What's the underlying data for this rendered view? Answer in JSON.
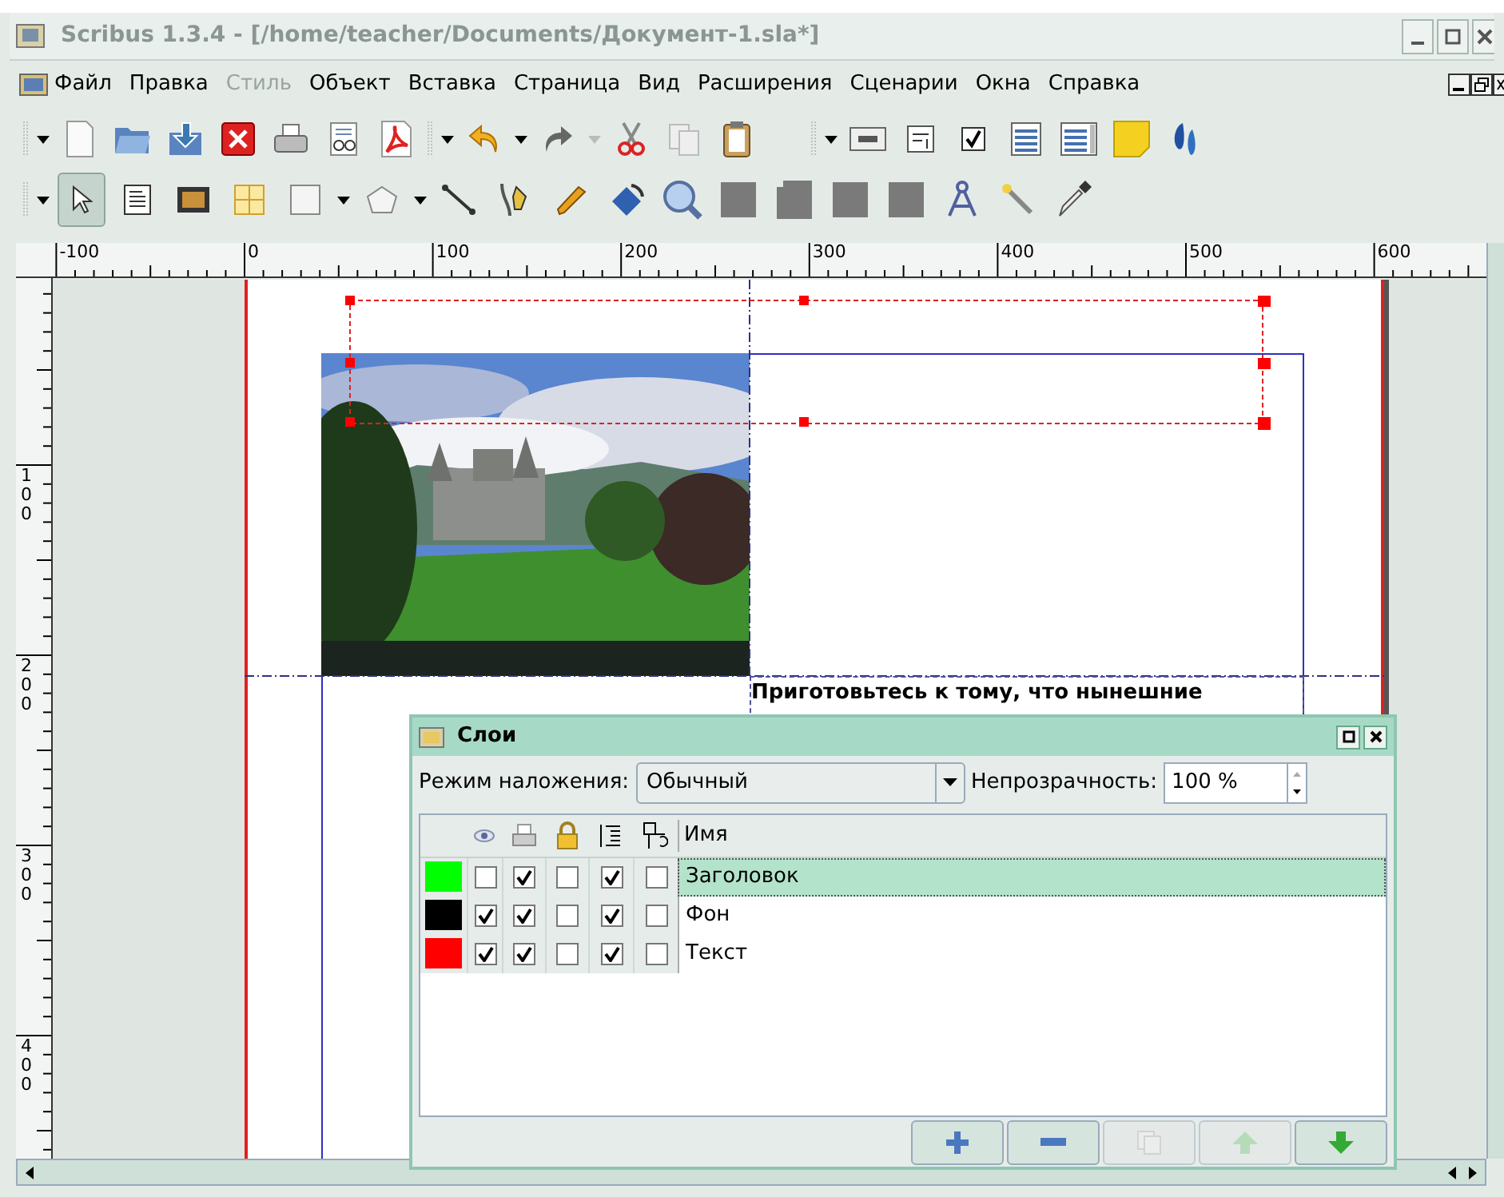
{
  "window": {
    "title": "Scribus 1.3.4 - [/home/teacher/Documents/Документ-1.sla*]"
  },
  "menu": [
    {
      "label": "Файл",
      "disabled": false
    },
    {
      "label": "Правка",
      "disabled": false
    },
    {
      "label": "Стиль",
      "disabled": true
    },
    {
      "label": "Объект",
      "disabled": false
    },
    {
      "label": "Вставка",
      "disabled": false
    },
    {
      "label": "Страница",
      "disabled": false
    },
    {
      "label": "Вид",
      "disabled": false
    },
    {
      "label": "Расширения",
      "disabled": false
    },
    {
      "label": "Сценарии",
      "disabled": false
    },
    {
      "label": "Окна",
      "disabled": false
    },
    {
      "label": "Справка",
      "disabled": false
    }
  ],
  "toolbox": [
    {
      "kind": "pointer",
      "selected": true
    },
    {
      "kind": "text_frame",
      "selected": false
    },
    {
      "kind": "image_frame",
      "selected": false
    },
    {
      "kind": "table",
      "selected": false
    },
    {
      "kind": "shape",
      "selected": false
    },
    {
      "kind": "polygon",
      "selected": false
    },
    {
      "kind": "line",
      "selected": false
    },
    {
      "kind": "bezier",
      "selected": false
    },
    {
      "kind": "freehand",
      "selected": false
    },
    {
      "kind": "rotate",
      "selected": false
    },
    {
      "kind": "zoom",
      "selected": false
    },
    {
      "kind": "block",
      "selected": false
    },
    {
      "kind": "block_tab",
      "selected": false
    },
    {
      "kind": "block",
      "selected": false
    },
    {
      "kind": "block",
      "selected": false
    },
    {
      "kind": "measure",
      "selected": false
    },
    {
      "kind": "link",
      "selected": false
    },
    {
      "kind": "eyedropper",
      "selected": false
    }
  ],
  "rulers": {
    "horizontal": [
      "-100",
      "0",
      "100",
      "200",
      "300",
      "400",
      "500",
      "600"
    ],
    "vertical": [
      "100",
      "200",
      "300",
      "400"
    ]
  },
  "document": {
    "text_frame": "Приготовьтесь к тому, что нынешние"
  },
  "layers_dialog": {
    "title": "Слои",
    "blend_label": "Режим наложения:",
    "blend_mode": "Обычный",
    "opacity_label": "Непрозрачность:",
    "opacity": "100 %",
    "name_column": "Имя",
    "rows": [
      {
        "color": "#00ff00",
        "visible": false,
        "printable": true,
        "locked": false,
        "flow": true,
        "outline": false,
        "name": "Заголовок",
        "selected": true
      },
      {
        "color": "#000000",
        "visible": true,
        "printable": true,
        "locked": false,
        "flow": true,
        "outline": false,
        "name": "Фон",
        "selected": false
      },
      {
        "color": "#ff0000",
        "visible": true,
        "printable": true,
        "locked": false,
        "flow": true,
        "outline": false,
        "name": "Текст",
        "selected": false
      }
    ],
    "buttons": [
      {
        "kind": "add",
        "disabled": false
      },
      {
        "kind": "remove",
        "disabled": false
      },
      {
        "kind": "duplicate",
        "disabled": true
      },
      {
        "kind": "raise",
        "disabled": true
      },
      {
        "kind": "lower",
        "disabled": false
      }
    ]
  }
}
